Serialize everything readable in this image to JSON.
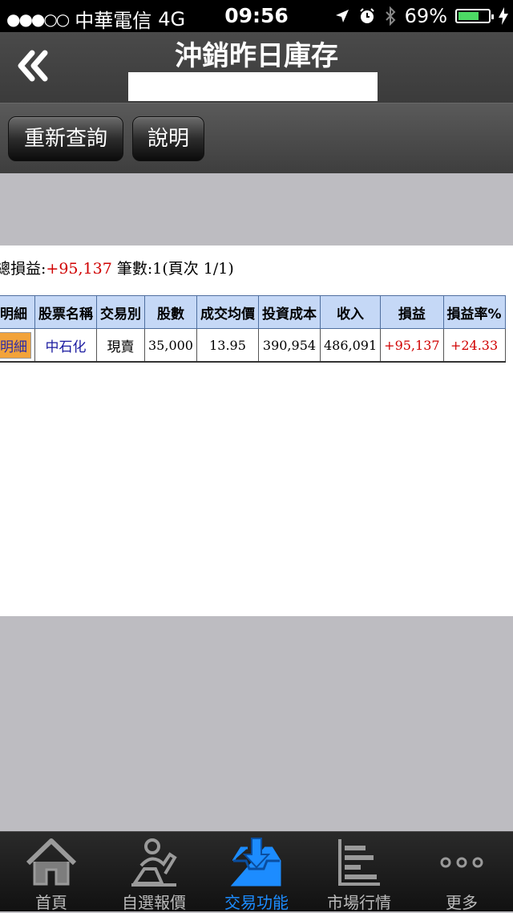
{
  "status_bar": {
    "carrier": "中華電信",
    "network": "4G",
    "time": "09:56",
    "battery": "69%",
    "battery_level": 0.69
  },
  "header": {
    "title": "沖銷昨日庫存",
    "subtitle": ""
  },
  "toolbar": {
    "requery_label": "重新查詢",
    "help_label": "說明"
  },
  "summary": {
    "pl_label": "總損益:",
    "pl_value": "+95,137",
    "count_text": "筆數:1(頁次 1/1)"
  },
  "table": {
    "headers": [
      "明細",
      "股票名稱",
      "交易別",
      "股數",
      "成交均價",
      "投資成本",
      "收入",
      "損益",
      "損益率%"
    ],
    "rows": [
      {
        "detail": "明細",
        "name": "中石化",
        "trade_type": "現賣",
        "shares": "35,000",
        "avg_price": "13.95",
        "cost": "390,954",
        "income": "486,091",
        "pl": "+95,137",
        "pl_rate": "+24.33"
      }
    ]
  },
  "tabbar": {
    "tabs": [
      {
        "label": "首頁",
        "icon": "home-icon"
      },
      {
        "label": "自選報價",
        "icon": "trader-icon"
      },
      {
        "label": "交易功能",
        "icon": "tray-download-icon"
      },
      {
        "label": "市場行情",
        "icon": "bar-list-icon"
      },
      {
        "label": "更多",
        "icon": "more-dots-icon"
      }
    ],
    "active_index": 2
  },
  "colors": {
    "positive": "#d00000",
    "header_cell": "#c5d8f6",
    "active_tab": "#1c8cff",
    "detail_chip": "#f2a33a"
  }
}
